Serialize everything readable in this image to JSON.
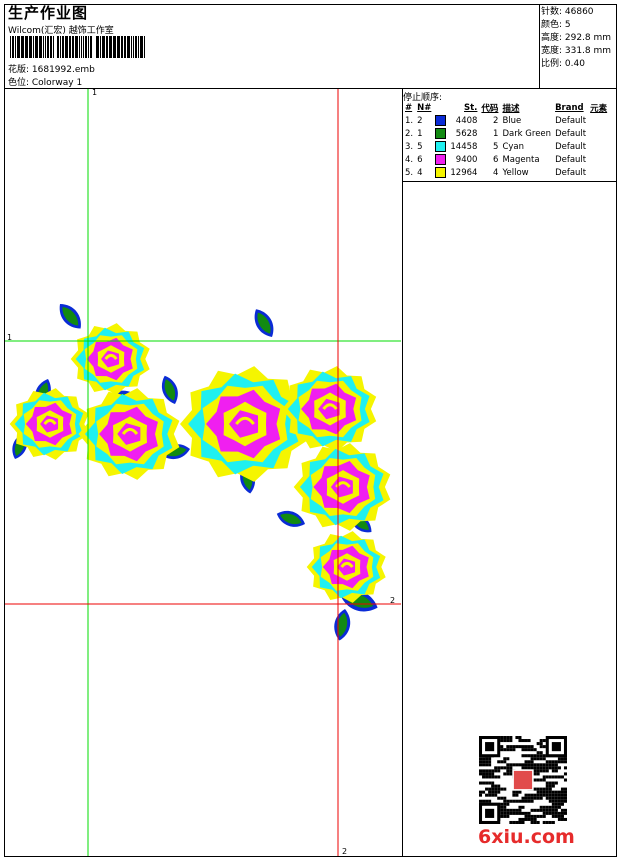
{
  "header": {
    "title": "生产作业图",
    "company": "Wilcom(汇宏) 越饰工作室",
    "pattern_file": "花版: 1681992.emb",
    "colorway": "色位: Colorway 1"
  },
  "stats": {
    "stitches": "针数: 46860",
    "colors": "颜色: 5",
    "height": "高度: 292.8 mm",
    "width": "宽度: 331.8 mm",
    "scale": "比例: 0.40"
  },
  "stop_sequence": {
    "title": "停止顺序:",
    "headers": [
      "#",
      "N#",
      "St.",
      "代码",
      "描述",
      "Brand",
      "元素"
    ],
    "rows": [
      {
        "index": "1.",
        "n": "2",
        "color": "#0a2bd6",
        "stitches": "4408",
        "code": "2",
        "desc": "Blue",
        "brand": "Default"
      },
      {
        "index": "2.",
        "n": "1",
        "color": "#128a12",
        "stitches": "5628",
        "code": "1",
        "desc": "Dark Green",
        "brand": "Default"
      },
      {
        "index": "3.",
        "n": "5",
        "color": "#1ff0f0",
        "stitches": "14458",
        "code": "5",
        "desc": "Cyan",
        "brand": "Default"
      },
      {
        "index": "4.",
        "n": "6",
        "color": "#f01ff0",
        "stitches": "9400",
        "code": "6",
        "desc": "Magenta",
        "brand": "Default"
      },
      {
        "index": "5.",
        "n": "4",
        "color": "#f5f500",
        "stitches": "12964",
        "code": "4",
        "desc": "Yellow",
        "brand": "Default"
      }
    ]
  },
  "guides": {
    "top": "1",
    "left": "1",
    "bottom": "2",
    "right": "2"
  },
  "watermark": "6xiu.com"
}
